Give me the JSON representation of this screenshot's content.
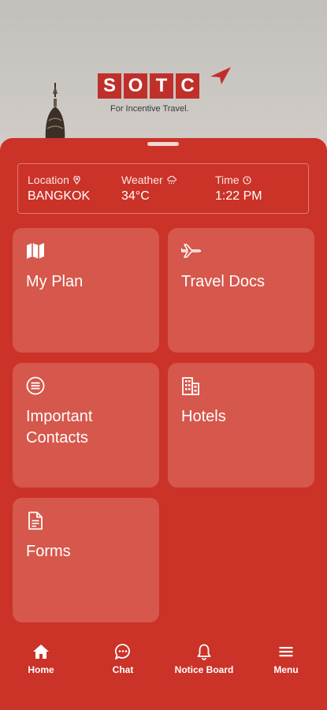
{
  "brand": {
    "letters": [
      "S",
      "O",
      "T",
      "C"
    ],
    "tagline": "For Incentive Travel.",
    "color": "#c0302b"
  },
  "info": {
    "location": {
      "label": "Location",
      "value": "BANGKOK",
      "icon": "location-pin-icon"
    },
    "weather": {
      "label": "Weather",
      "value": "34°C",
      "icon": "cloud-rain-icon"
    },
    "time": {
      "label": "Time",
      "value": "1:22 PM",
      "icon": "clock-icon"
    }
  },
  "tiles": [
    {
      "label": "My Plan",
      "icon": "map-icon"
    },
    {
      "label": "Travel Docs",
      "icon": "airplane-icon"
    },
    {
      "label": "Important Contacts",
      "icon": "contacts-list-icon"
    },
    {
      "label": "Hotels",
      "icon": "building-icon"
    },
    {
      "label": "Forms",
      "icon": "document-icon"
    }
  ],
  "nav": [
    {
      "label": "Home",
      "icon": "home-icon"
    },
    {
      "label": "Chat",
      "icon": "chat-icon"
    },
    {
      "label": "Notice Board",
      "icon": "bell-icon"
    },
    {
      "label": "Menu",
      "icon": "menu-icon"
    }
  ],
  "colors": {
    "primary": "#cb3228",
    "tile": "#d6574b"
  }
}
